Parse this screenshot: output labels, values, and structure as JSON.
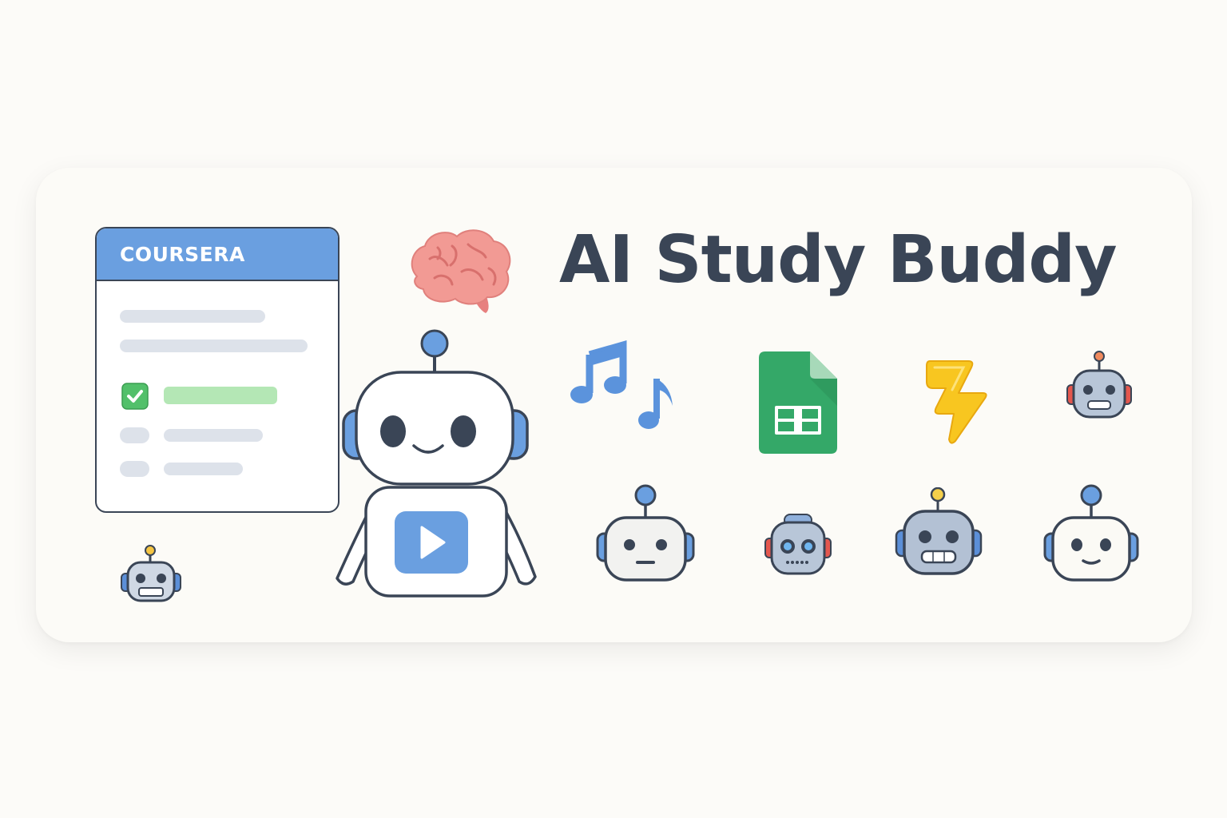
{
  "banner": {
    "title": "AI Study Buddy",
    "course_window": {
      "header_label": "COURSERA",
      "items": [
        {
          "type": "text-line"
        },
        {
          "type": "text-line"
        },
        {
          "type": "checklist-item",
          "checked": true
        },
        {
          "type": "checklist-item",
          "checked": false
        },
        {
          "type": "checklist-item",
          "checked": false
        }
      ]
    },
    "icons": [
      "brain-icon",
      "music-notes-icon",
      "google-sheets-icon",
      "lightning-bolt-icon",
      "robot-mascot-icon",
      "play-button-icon"
    ],
    "robot_icons": [
      "robot-icon-small-bottom-left",
      "robot-icon-top-right",
      "robot-icon-row-1",
      "robot-icon-row-2",
      "robot-icon-row-3",
      "robot-icon-row-4"
    ]
  },
  "colors": {
    "background": "#fcfbf8",
    "ink": "#3a4556",
    "accent_blue": "#6a9fe0",
    "green_check": "#52c06a",
    "sheets_green": "#34a868",
    "bolt_yellow": "#f8c620",
    "brain_pink": "#ef8c88"
  }
}
